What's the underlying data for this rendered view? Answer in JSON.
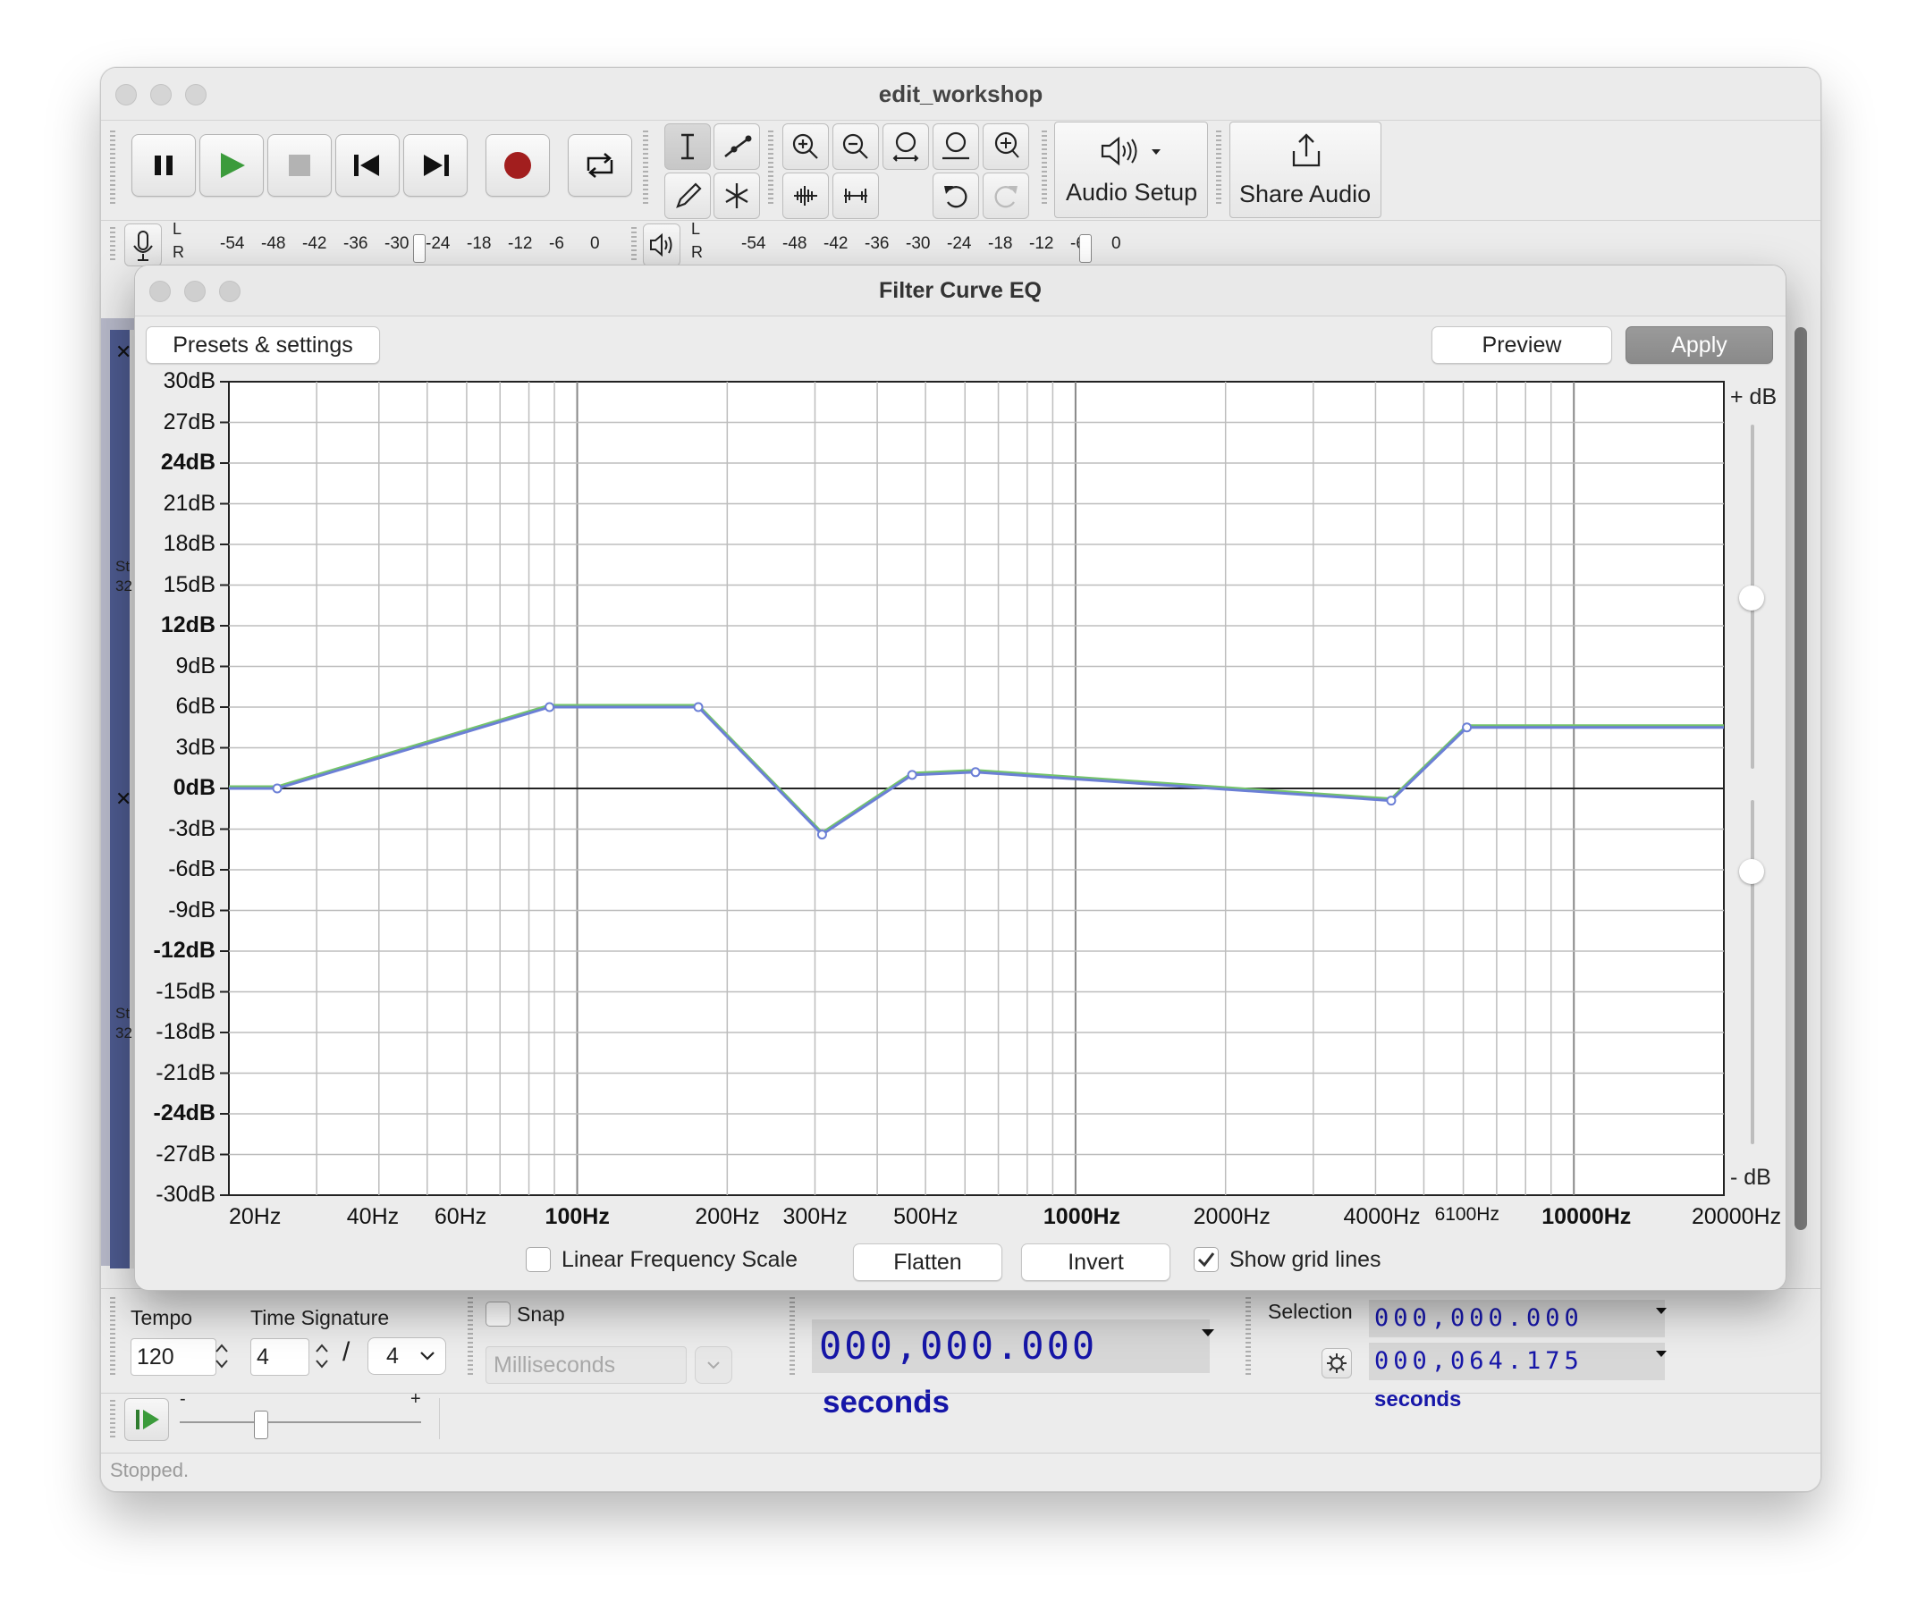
{
  "window": {
    "title": "edit_workshop"
  },
  "toolbar": {
    "audio_setup_label": "Audio Setup",
    "share_audio_label": "Share Audio"
  },
  "meters": {
    "record_lr": [
      "L",
      "R"
    ],
    "record_ticks": [
      "-54",
      "-48",
      "-42",
      "-36",
      "-30",
      "-24",
      "-18",
      "-12",
      "-6",
      "0"
    ],
    "play_lr": [
      "L",
      "R"
    ],
    "play_ticks": [
      "-54",
      "-48",
      "-42",
      "-36",
      "-30",
      "-24",
      "-18",
      "-12",
      "-6",
      "0"
    ]
  },
  "track_fragments": {
    "t1": [
      "St",
      "32"
    ],
    "t2": [
      "St",
      "32"
    ]
  },
  "dialog": {
    "title": "Filter Curve EQ",
    "presets_label": "Presets & settings",
    "preview_label": "Preview",
    "apply_label": "Apply",
    "plus_db": "+ dB",
    "minus_db": "- dB",
    "linear_scale_label": "Linear Frequency Scale",
    "linear_scale_checked": false,
    "flatten_label": "Flatten",
    "invert_label": "Invert",
    "grid_lines_label": "Show grid lines",
    "grid_lines_checked": true
  },
  "chart_data": {
    "type": "line",
    "title": "",
    "xscale": "log",
    "xlim": [
      20,
      20000
    ],
    "ylim": [
      -30,
      30
    ],
    "grid": true,
    "y_ticks": [
      "30dB",
      "27dB",
      "24dB",
      "21dB",
      "18dB",
      "15dB",
      "12dB",
      "9dB",
      "6dB",
      "3dB",
      "0dB",
      "-3dB",
      "-6dB",
      "-9dB",
      "-12dB",
      "-15dB",
      "-18dB",
      "-21dB",
      "-24dB",
      "-27dB",
      "-30dB"
    ],
    "x_ticks": [
      "20Hz",
      "40Hz",
      "60Hz",
      "100Hz",
      "200Hz",
      "300Hz",
      "500Hz",
      "1000Hz",
      "2000Hz",
      "4000Hz",
      "6100Hz",
      "10000Hz",
      "20000Hz"
    ],
    "series": [
      {
        "x": [
          20,
          25,
          88,
          175,
          310,
          470,
          630,
          4300,
          6100,
          20000
        ],
        "y": [
          0,
          0,
          6,
          6,
          -3.4,
          1,
          1.2,
          -0.9,
          4.5,
          4.5
        ],
        "color": "#6b7fd6"
      }
    ],
    "curve_color_secondary": "#74c46b"
  },
  "bottom": {
    "tempo_label": "Tempo",
    "tempo_value": "120",
    "timesig_label": "Time Signature",
    "timesig_num": "4",
    "timesig_sep": "/",
    "timesig_den": "4",
    "snap_label": "Snap",
    "snap_unit": "Milliseconds",
    "time_value": "000,000.000",
    "time_unit": "seconds",
    "selection_label": "Selection",
    "sel_start": "000,000.000",
    "sel_end": "000,064.175",
    "sel_unit": "seconds",
    "playspeed_minus": "-",
    "playspeed_plus": "+"
  },
  "status": {
    "text": "Stopped."
  }
}
